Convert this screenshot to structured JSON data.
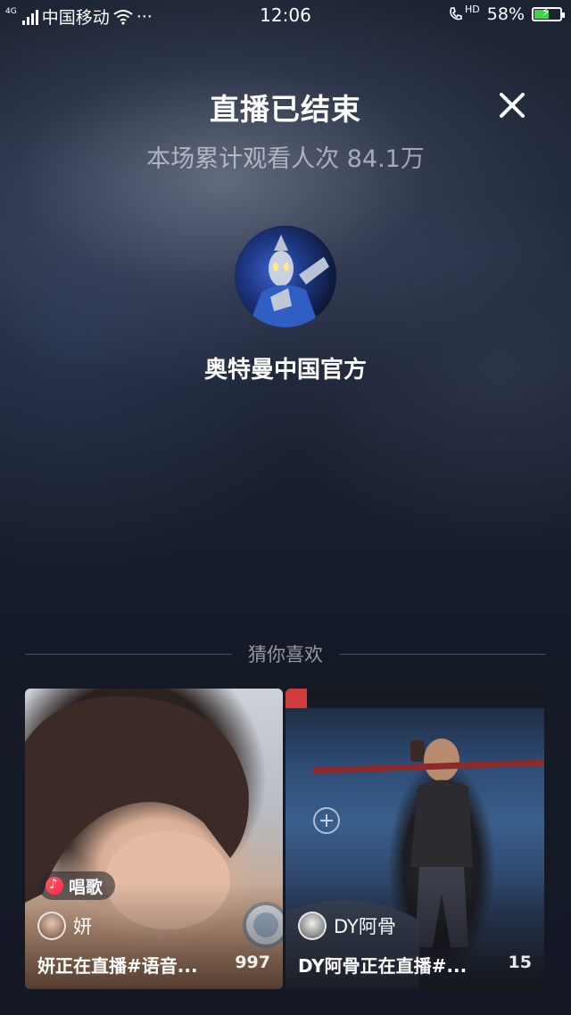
{
  "status_bar": {
    "network": "4G",
    "carrier": "中国移动",
    "more": "···",
    "time": "12:06",
    "call_label": "HD",
    "battery_percent": "58%",
    "battery_level": 0.58
  },
  "header": {
    "title": "直播已结束",
    "viewers_text": "本场累计观看人次 84.1万"
  },
  "host": {
    "name": "奥特曼中国官方"
  },
  "recommend": {
    "label": "猜你喜欢",
    "cards": [
      {
        "tag": "唱歌",
        "user": "妍",
        "caption": "妍正在直播#语音...",
        "count": "997"
      },
      {
        "user": "DY阿骨",
        "caption": "DY阿骨正在直播#...",
        "count": "15"
      }
    ]
  }
}
